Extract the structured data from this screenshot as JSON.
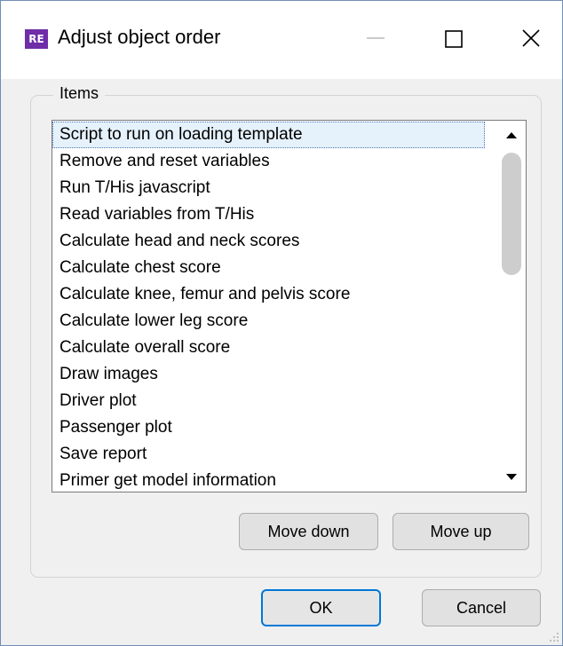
{
  "window": {
    "app_icon_text": "RE",
    "title": "Adjust object order",
    "controls": {
      "minimize_icon": "minimize-icon",
      "maximize_icon": "maximize-icon",
      "close_icon": "close-icon"
    }
  },
  "items_group": {
    "label": "Items",
    "list": [
      "Script to run on loading template",
      "Remove and reset variables",
      "Run T/His javascript",
      "Read variables from T/His",
      "Calculate head and neck scores",
      "Calculate chest score",
      "Calculate knee, femur and pelvis score",
      "Calculate lower leg score",
      "Calculate overall score",
      "Draw images",
      "Driver plot",
      "Passenger plot",
      "Save report",
      "Primer get model information"
    ],
    "selected_item": "Script to run on loading template",
    "move_down_label": "Move down",
    "move_up_label": "Move up"
  },
  "dialog_buttons": {
    "ok_label": "OK",
    "cancel_label": "Cancel"
  },
  "colors": {
    "app_icon_bg": "#6f2da8",
    "selection_bg": "#e5f1fb",
    "default_button_border": "#0078d7",
    "window_border": "#6f8fb6"
  }
}
